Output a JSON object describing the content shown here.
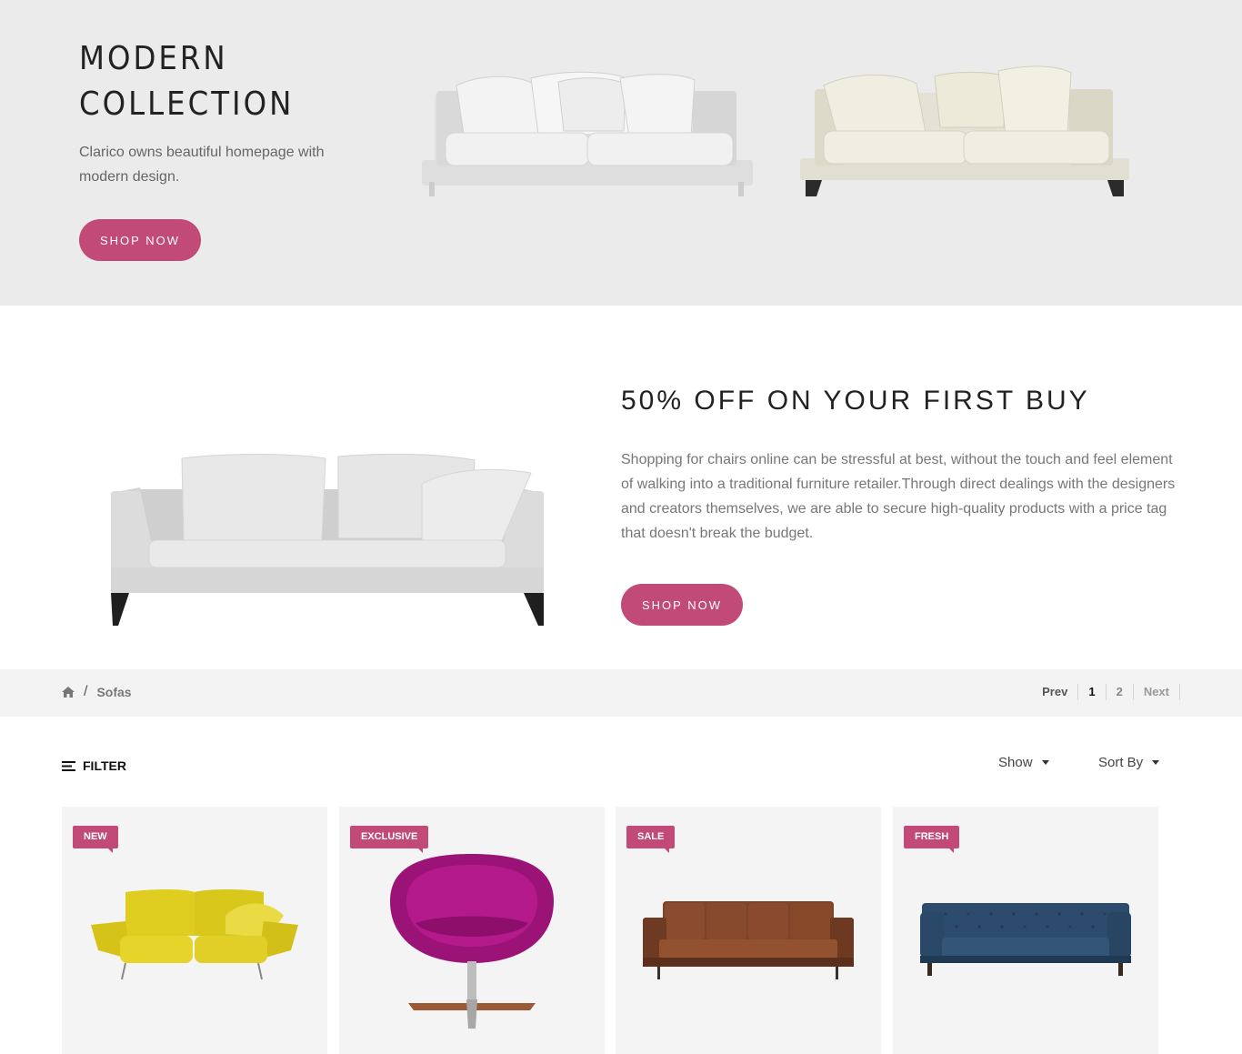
{
  "hero": {
    "title_line1": "MODERN",
    "title_line2": "COLLECTION",
    "description": "Clarico owns beautiful homepage with modern design.",
    "button_label": "SHOP NOW"
  },
  "promo": {
    "title": "50% OFF ON YOUR FIRST BUY",
    "description": "Shopping for chairs online can be stressful at best, without the touch and feel element of walking into a traditional furniture retailer.Through direct dealings with the designers and creators themselves, we are able to secure high-quality products with a price tag that doesn't break the budget.",
    "button_label": "SHOP NOW"
  },
  "breadcrumb": {
    "home_icon": "home-icon",
    "separator": "/",
    "current": "Sofas"
  },
  "pagination": {
    "prev": "Prev",
    "pages": [
      "1",
      "2"
    ],
    "active_page": "1",
    "next": "Next"
  },
  "toolbar": {
    "filter_icon": "filter-lines-icon",
    "filter_label": "FILTER",
    "show_label": "Show",
    "sort_label": "Sort By"
  },
  "products": [
    {
      "badge": "NEW",
      "image": "yellow-sofa"
    },
    {
      "badge": "EXCLUSIVE",
      "image": "magenta-egg-chair"
    },
    {
      "badge": "SALE",
      "image": "brown-leather-sofa"
    },
    {
      "badge": "FRESH",
      "image": "blue-tufted-sofa"
    }
  ],
  "colors": {
    "accent": "#c24a77",
    "hero_bg": "#ebebeb",
    "bar_bg": "#f3f3f3",
    "card_bg": "#f4f4f4"
  }
}
